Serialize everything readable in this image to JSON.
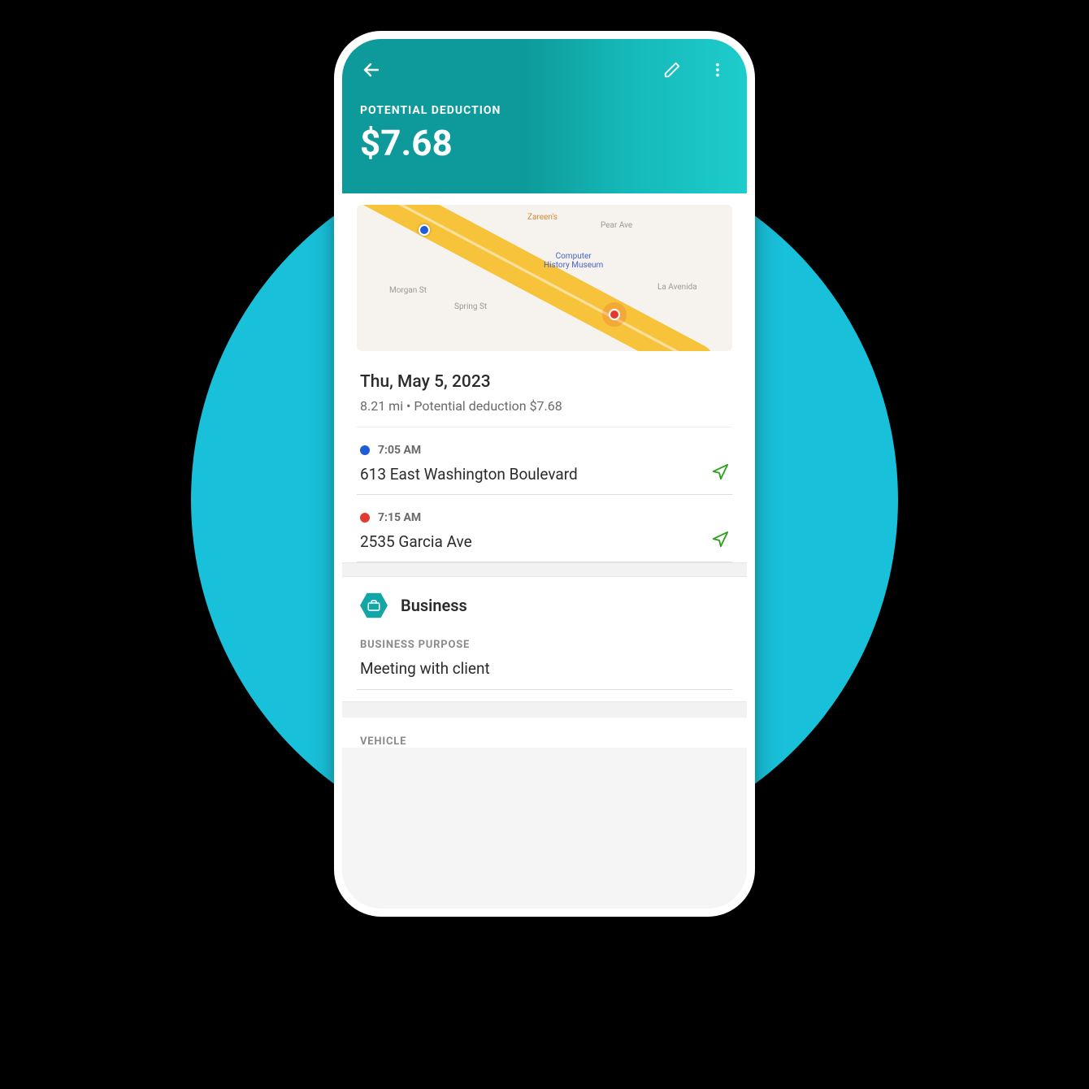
{
  "header": {
    "label": "POTENTIAL DEDUCTION",
    "amount": "$7.68"
  },
  "trip": {
    "date": "Thu, May 5, 2023",
    "summary": "8.21 mi • Potential deduction $7.68",
    "start": {
      "time": "7:05 AM",
      "address": "613 East Washington Boulevard"
    },
    "end": {
      "time": "7:15 AM",
      "address": "2535 Garcia Ave"
    }
  },
  "map": {
    "poi_zareens": "Zareen's",
    "poi_museum": "Computer\nHistory Museum",
    "street_pear": "Pear Ave",
    "street_morgan": "Morgan St",
    "street_spring": "Spring St",
    "street_avenida": "La Avenida"
  },
  "category": {
    "name": "Business",
    "purpose_label": "BUSINESS PURPOSE",
    "purpose_value": "Meeting with client"
  },
  "vehicle": {
    "label": "VEHICLE"
  }
}
